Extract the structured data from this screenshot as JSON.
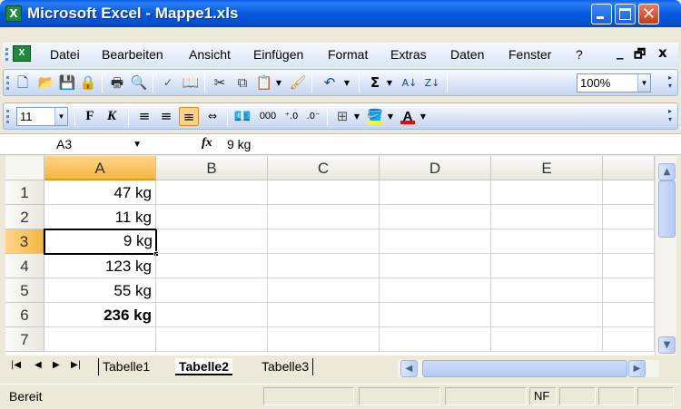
{
  "window": {
    "title": "Microsoft Excel - Mappe1.xls",
    "minimize_icon": "minimize-icon",
    "maximize_icon": "maximize-icon",
    "close_icon": "close-icon"
  },
  "menu": {
    "items": [
      "Datei",
      "Bearbeiten",
      "Ansicht",
      "Einfügen",
      "Format",
      "Extras",
      "Daten",
      "Fenster",
      "?"
    ],
    "window_controls": [
      "_",
      "🗗",
      "x"
    ]
  },
  "toolbar_standard": {
    "buttons": [
      "new-icon",
      "open-icon",
      "save-icon",
      "permission-icon",
      "print-icon",
      "print-preview-icon",
      "spelling-icon",
      "research-icon",
      "cut-icon",
      "copy-icon",
      "paste-icon",
      "format-painter-icon",
      "undo-icon",
      "autosum-icon",
      "sort-ascending-icon",
      "sort-descending-icon"
    ],
    "zoom": "100%"
  },
  "toolbar_format": {
    "font_size": "11",
    "bold_label": "F",
    "italic_label": "K",
    "buttons": [
      "align-left-icon",
      "align-center-icon",
      "align-right-icon",
      "merge-center-icon",
      "currency-icon",
      "thousands-icon",
      "increase-decimal-icon",
      "decrease-decimal-icon",
      "borders-icon",
      "fill-color-icon",
      "font-color-icon"
    ],
    "thousands_label": "000",
    "font_color_label": "A"
  },
  "formula_bar": {
    "name_box": "A3",
    "fx_label": "fx",
    "value": "9 kg"
  },
  "grid": {
    "columns": [
      "A",
      "B",
      "C",
      "D",
      "E"
    ],
    "rows": [
      "1",
      "2",
      "3",
      "4",
      "5",
      "6",
      "7"
    ],
    "selected_column": "A",
    "selected_row": "3",
    "cells_a": [
      "47 kg",
      "11 kg",
      "9 kg",
      "123 kg",
      "55 kg",
      "236 kg",
      ""
    ]
  },
  "sheets": {
    "tabs": [
      "Tabelle1",
      "Tabelle2",
      "Tabelle3"
    ],
    "active": "Tabelle2"
  },
  "status": {
    "text": "Bereit",
    "indicator": "NF"
  }
}
